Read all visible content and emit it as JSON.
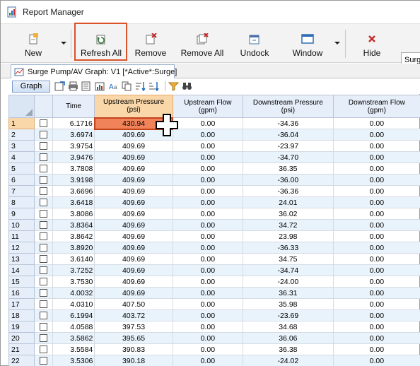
{
  "window": {
    "title": "Report Manager"
  },
  "ribbon": {
    "new_label": "New",
    "refresh_all_label": "Refresh All",
    "remove_label": "Remove",
    "remove_all_label": "Remove All",
    "undock_label": "Undock",
    "window_label": "Window",
    "hide_label": "Hide",
    "scenario_value": "Surg",
    "highlight_color": "#d9542b"
  },
  "tab": {
    "label": "Surge Pump/AV Graph: V1 [*Active*:Surge]"
  },
  "toolbar": {
    "graph_label": "Graph"
  },
  "table": {
    "columns": [
      {
        "name": "Time",
        "unit": ""
      },
      {
        "name": "Upstream Pressure",
        "unit": "(psi)"
      },
      {
        "name": "Upstream Flow",
        "unit": "(gpm)"
      },
      {
        "name": "Downstream Pressure",
        "unit": "(psi)"
      },
      {
        "name": "Downstream Flow",
        "unit": "(gpm)"
      }
    ],
    "rows": [
      {
        "n": "1",
        "time": "6.1716",
        "up_p": "430.94",
        "up_f": "0.00",
        "dn_p": "-34.36",
        "dn_f": "0.00"
      },
      {
        "n": "2",
        "time": "3.6974",
        "up_p": "409.69",
        "up_f": "0.00",
        "dn_p": "-36.04",
        "dn_f": "0.00"
      },
      {
        "n": "3",
        "time": "3.9754",
        "up_p": "409.69",
        "up_f": "0.00",
        "dn_p": "-23.97",
        "dn_f": "0.00"
      },
      {
        "n": "4",
        "time": "3.9476",
        "up_p": "409.69",
        "up_f": "0.00",
        "dn_p": "-34.70",
        "dn_f": "0.00"
      },
      {
        "n": "5",
        "time": "3.7808",
        "up_p": "409.69",
        "up_f": "0.00",
        "dn_p": "36.35",
        "dn_f": "0.00"
      },
      {
        "n": "6",
        "time": "3.9198",
        "up_p": "409.69",
        "up_f": "0.00",
        "dn_p": "-36.00",
        "dn_f": "0.00"
      },
      {
        "n": "7",
        "time": "3.6696",
        "up_p": "409.69",
        "up_f": "0.00",
        "dn_p": "-36.36",
        "dn_f": "0.00"
      },
      {
        "n": "8",
        "time": "3.6418",
        "up_p": "409.69",
        "up_f": "0.00",
        "dn_p": "24.01",
        "dn_f": "0.00"
      },
      {
        "n": "9",
        "time": "3.8086",
        "up_p": "409.69",
        "up_f": "0.00",
        "dn_p": "36.02",
        "dn_f": "0.00"
      },
      {
        "n": "10",
        "time": "3.8364",
        "up_p": "409.69",
        "up_f": "0.00",
        "dn_p": "34.72",
        "dn_f": "0.00"
      },
      {
        "n": "11",
        "time": "3.8642",
        "up_p": "409.69",
        "up_f": "0.00",
        "dn_p": "23.98",
        "dn_f": "0.00"
      },
      {
        "n": "12",
        "time": "3.8920",
        "up_p": "409.69",
        "up_f": "0.00",
        "dn_p": "-36.33",
        "dn_f": "0.00"
      },
      {
        "n": "13",
        "time": "3.6140",
        "up_p": "409.69",
        "up_f": "0.00",
        "dn_p": "34.75",
        "dn_f": "0.00"
      },
      {
        "n": "14",
        "time": "3.7252",
        "up_p": "409.69",
        "up_f": "0.00",
        "dn_p": "-34.74",
        "dn_f": "0.00"
      },
      {
        "n": "15",
        "time": "3.7530",
        "up_p": "409.69",
        "up_f": "0.00",
        "dn_p": "-24.00",
        "dn_f": "0.00"
      },
      {
        "n": "16",
        "time": "4.0032",
        "up_p": "409.69",
        "up_f": "0.00",
        "dn_p": "36.31",
        "dn_f": "0.00"
      },
      {
        "n": "17",
        "time": "4.0310",
        "up_p": "407.50",
        "up_f": "0.00",
        "dn_p": "35.98",
        "dn_f": "0.00"
      },
      {
        "n": "18",
        "time": "6.1994",
        "up_p": "403.72",
        "up_f": "0.00",
        "dn_p": "-23.69",
        "dn_f": "0.00"
      },
      {
        "n": "19",
        "time": "4.0588",
        "up_p": "397.53",
        "up_f": "0.00",
        "dn_p": "34.68",
        "dn_f": "0.00"
      },
      {
        "n": "20",
        "time": "3.5862",
        "up_p": "395.65",
        "up_f": "0.00",
        "dn_p": "36.06",
        "dn_f": "0.00"
      },
      {
        "n": "21",
        "time": "3.5584",
        "up_p": "390.83",
        "up_f": "0.00",
        "dn_p": "36.38",
        "dn_f": "0.00"
      },
      {
        "n": "22",
        "time": "3.5306",
        "up_p": "390.18",
        "up_f": "0.00",
        "dn_p": "-24.02",
        "dn_f": "0.00"
      }
    ]
  }
}
